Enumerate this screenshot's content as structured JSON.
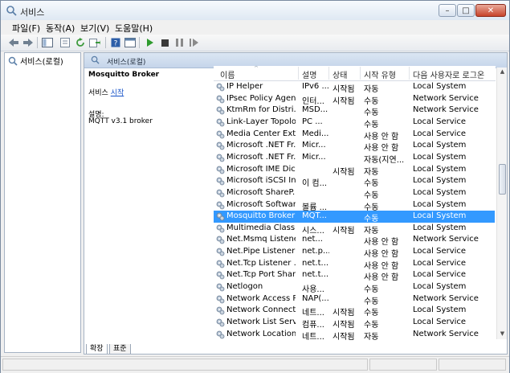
{
  "window": {
    "title": "서비스"
  },
  "menu": [
    "파일(F)",
    "동작(A)",
    "보기(V)",
    "도움말(H)"
  ],
  "toolbar": {
    "icons": [
      "back-icon",
      "forward-icon",
      "show-tree-icon",
      "properties-icon",
      "refresh-icon",
      "export-icon",
      "help-icon",
      "console-icon",
      "play-icon",
      "stop-icon",
      "pause-icon",
      "restart-icon"
    ]
  },
  "tree": {
    "root_label": "서비스(로컬)"
  },
  "right_header": {
    "label": "서비스(로컬)"
  },
  "description": {
    "service_name": "Mosquitto Broker",
    "action_prefix": "서비스 ",
    "action_link": "시작",
    "desc_label": "설명:",
    "desc_text": "MQTT v3.1 broker"
  },
  "columns": [
    "이름",
    "설명",
    "상태",
    "시작 유형",
    "다음 사용자로 로그온"
  ],
  "rows": [
    {
      "name": "IP Helper",
      "desc": "IPv6 ...",
      "status": "시작됨",
      "startup": "자동",
      "logon": "Local System",
      "selected": false
    },
    {
      "name": "IPsec Policy Agent",
      "desc": "인터...",
      "status": "시작됨",
      "startup": "수동",
      "logon": "Network Service",
      "selected": false
    },
    {
      "name": "KtmRm for Distri...",
      "desc": "MSD...",
      "status": "",
      "startup": "수동",
      "logon": "Network Service",
      "selected": false
    },
    {
      "name": "Link-Layer Topolo...",
      "desc": "PC ...",
      "status": "",
      "startup": "수동",
      "logon": "Local Service",
      "selected": false
    },
    {
      "name": "Media Center Ext...",
      "desc": "Medi...",
      "status": "",
      "startup": "사용 안 함",
      "logon": "Local Service",
      "selected": false
    },
    {
      "name": "Microsoft .NET Fr...",
      "desc": "Micr...",
      "status": "",
      "startup": "사용 안 함",
      "logon": "Local System",
      "selected": false
    },
    {
      "name": "Microsoft .NET Fr...",
      "desc": "Micr...",
      "status": "",
      "startup": "자동(지연...",
      "logon": "Local System",
      "selected": false
    },
    {
      "name": "Microsoft IME Dic...",
      "desc": "",
      "status": "시작됨",
      "startup": "자동",
      "logon": "Local System",
      "selected": false
    },
    {
      "name": "Microsoft iSCSI In...",
      "desc": "이 컴...",
      "status": "",
      "startup": "수동",
      "logon": "Local System",
      "selected": false
    },
    {
      "name": "Microsoft ShareP...",
      "desc": "",
      "status": "",
      "startup": "수동",
      "logon": "Local System",
      "selected": false
    },
    {
      "name": "Microsoft Softwar...",
      "desc": "볼륨 ...",
      "status": "",
      "startup": "수동",
      "logon": "Local System",
      "selected": false
    },
    {
      "name": "Mosquitto Broker",
      "desc": "MQT...",
      "status": "",
      "startup": "수동",
      "logon": "Local System",
      "selected": true
    },
    {
      "name": "Multimedia Class ...",
      "desc": "시스...",
      "status": "시작됨",
      "startup": "자동",
      "logon": "Local System",
      "selected": false
    },
    {
      "name": "Net.Msmq Listene...",
      "desc": "net...",
      "status": "",
      "startup": "사용 안 함",
      "logon": "Network Service",
      "selected": false
    },
    {
      "name": "Net.Pipe Listener ...",
      "desc": "net.p...",
      "status": "",
      "startup": "사용 안 함",
      "logon": "Local Service",
      "selected": false
    },
    {
      "name": "Net.Tcp Listener ...",
      "desc": "net.t...",
      "status": "",
      "startup": "사용 안 함",
      "logon": "Local Service",
      "selected": false
    },
    {
      "name": "Net.Tcp Port Shar...",
      "desc": "net.t...",
      "status": "",
      "startup": "사용 안 함",
      "logon": "Local Service",
      "selected": false
    },
    {
      "name": "Netlogon",
      "desc": "사용...",
      "status": "",
      "startup": "수동",
      "logon": "Local System",
      "selected": false
    },
    {
      "name": "Network Access P...",
      "desc": "NAP(...",
      "status": "",
      "startup": "수동",
      "logon": "Network Service",
      "selected": false
    },
    {
      "name": "Network Connecti...",
      "desc": "네트...",
      "status": "시작됨",
      "startup": "수동",
      "logon": "Local System",
      "selected": false
    },
    {
      "name": "Network List Servi...",
      "desc": "컴퓨...",
      "status": "시작됨",
      "startup": "수동",
      "logon": "Local Service",
      "selected": false
    },
    {
      "name": "Network Location...",
      "desc": "네트...",
      "status": "시작됨",
      "startup": "자동",
      "logon": "Network Service",
      "selected": false
    }
  ],
  "tabs": [
    "확장",
    "표준"
  ],
  "colors": {
    "selection": "#3399ff",
    "header_gradient": "#c5d5ea"
  }
}
